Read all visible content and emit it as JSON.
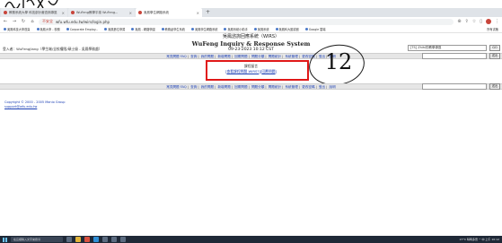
{
  "browser": {
    "tabs": [
      {
        "label": "教務系統大學 科技部計畫查詢專區",
        "active": false
      },
      {
        "label": "WuFeng教學平臺 WuFeng...",
        "active": false
      },
      {
        "label": "吳鳳學生網路系統",
        "active": true
      }
    ],
    "new_tab": "+",
    "url": "wfu.wfu.edu.tw/wirs/login.php",
    "url_prefix": "不安全",
    "bookmarks": [
      "吳鳳科技大學首頁",
      "吳鳳大學 - 校務",
      "Corporate Employ...",
      "吳鳳數位學習",
      "吳鳳 - 網路學園",
      "教務處學生系統",
      "吳鳳學生網路系統",
      "吳鳳系統小助手",
      "吳鳳系統",
      "吳鳳科大圖書館",
      "Google 雲端",
      "所有書籤"
    ]
  },
  "header": {
    "title_zh": "吳鳳諮詢回應系統（WIRS）",
    "title_en": "WuFeng Inquiry & Response System",
    "datetime": "09-23-2023 10:12 CST"
  },
  "user": {
    "line": "登入者：WuFengJiang（學生端/全校權限/碩士級 - 吳鳳學務處）"
  },
  "search": {
    "selected": "[TS] Zhihi的教學專區",
    "go_label": "GO",
    "submit_label": "送出"
  },
  "menu": {
    "items": [
      "常見問題 FAQ",
      "查詢",
      "我的問題",
      "新增問題",
      "回覆問題",
      "問題分類",
      "問題統計",
      "系統管理",
      "更改密碼",
      "登出",
      "說明"
    ]
  },
  "main": {
    "section_title": "課程留言",
    "link_prefix": "[",
    "link1": "查看課程問題 WIRS?",
    "link_sep": "][",
    "link2": "回覆問題",
    "link_suffix": "]"
  },
  "annotation": {
    "number": "12"
  },
  "footer": {
    "copyright": "Copyright © 2000 - 2005 Manio Group",
    "email": "support@wfu.edu.tw"
  },
  "taskbar": {
    "search_placeholder": "在這裡輸入文字來搜尋",
    "tray": "27°C 晴時多雲   ^  中   上午 10:12"
  },
  "colors": {
    "link": "#1b3fb4",
    "highlight_box": "#e01818"
  }
}
